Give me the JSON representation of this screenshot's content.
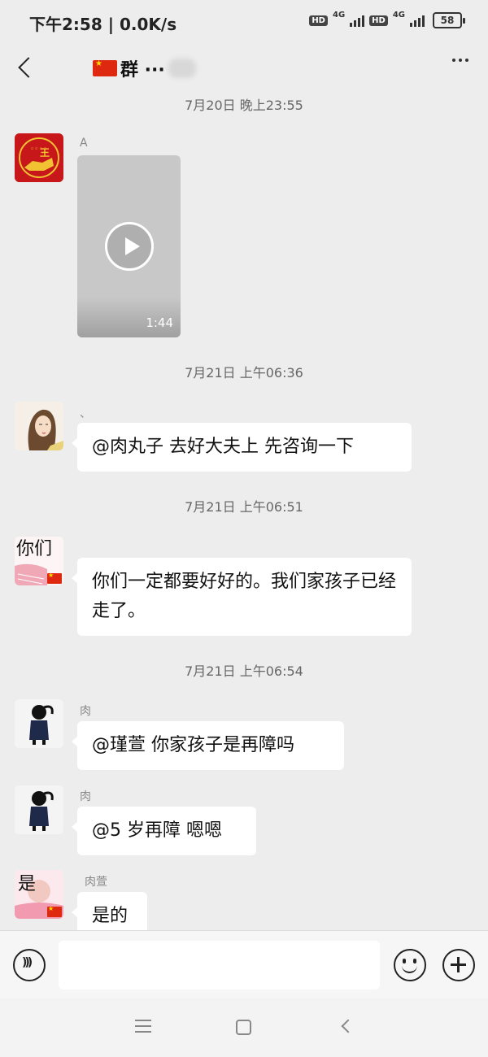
{
  "status_bar": {
    "time": "下午2:58 | 0.0K/s",
    "hd1": "HD",
    "net1": "4G",
    "hd2": "HD",
    "net2": "4G",
    "battery": "58"
  },
  "header": {
    "title": "群 ···"
  },
  "messages": [
    {
      "type": "timestamp",
      "text": "7月20日 晚上23:55"
    },
    {
      "type": "video",
      "sender": "A",
      "duration": "1:44"
    },
    {
      "type": "timestamp",
      "text": "7月21日 上午06:36"
    },
    {
      "type": "text",
      "sender": "、",
      "text": "@肉丸子  去好大夫上  先咨询一下"
    },
    {
      "type": "timestamp",
      "text": "7月21日 上午06:51"
    },
    {
      "type": "text",
      "sender": "",
      "avatar_text": "你们",
      "text": "你们一定都要好好的。我们家孩子已经走了。"
    },
    {
      "type": "timestamp",
      "text": "7月21日 上午06:54"
    },
    {
      "type": "text",
      "sender": "肉",
      "text": "@瑾萱  你家孩子是再障吗"
    },
    {
      "type": "text",
      "sender": "肉",
      "text": "@5 岁再障  嗯嗯"
    },
    {
      "type": "text",
      "sender": "肉萱",
      "avatar_text": "是",
      "text": "是的"
    }
  ],
  "input_bar": {
    "placeholder": ""
  },
  "colors": {
    "background": "#ededed",
    "bubble": "#ffffff",
    "flag_red": "#de2910",
    "flag_star": "#ffde00"
  }
}
